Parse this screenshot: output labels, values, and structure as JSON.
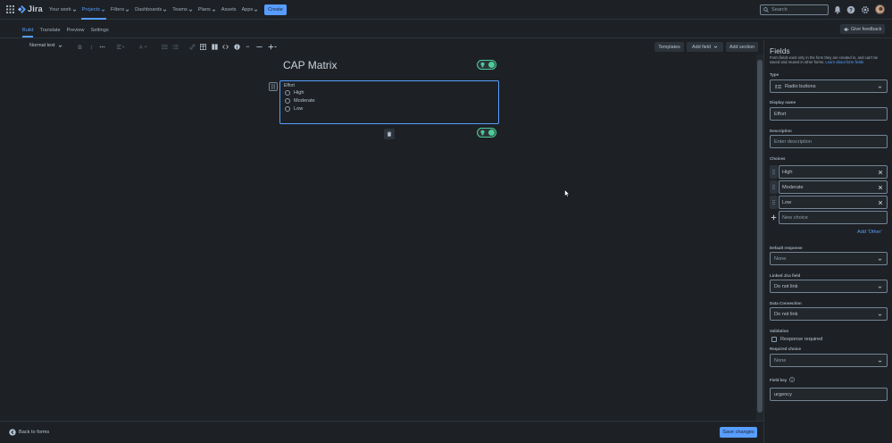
{
  "topnav": {
    "logo_text": "Jira",
    "items": [
      {
        "label": "Your work",
        "active": false
      },
      {
        "label": "Projects",
        "active": true
      },
      {
        "label": "Filters",
        "active": false
      },
      {
        "label": "Dashboards",
        "active": false
      },
      {
        "label": "Teams",
        "active": false
      },
      {
        "label": "Plans",
        "active": false
      },
      {
        "label": "Assets",
        "active": false
      },
      {
        "label": "Apps",
        "active": false
      }
    ],
    "create_label": "Create",
    "search_placeholder": "Search"
  },
  "subtabs": [
    {
      "label": "Build",
      "active": true
    },
    {
      "label": "Translate",
      "active": false
    },
    {
      "label": "Preview",
      "active": false
    },
    {
      "label": "Settings",
      "active": false
    }
  ],
  "feedback_label": "Give feedback",
  "toolbar": {
    "text_style": "Normal text",
    "templates_label": "Templates",
    "add_field_label": "Add field",
    "add_section_label": "Add section"
  },
  "form": {
    "title": "CAP Matrix",
    "field_label": "Effort",
    "options": [
      "High",
      "Moderate",
      "Low"
    ]
  },
  "bottom": {
    "back_label": "Back to forms",
    "save_label": "Save changes"
  },
  "panel": {
    "title": "Fields",
    "description": "Form fields exist only in the form they are created in, and can't be saved and reused in other forms.",
    "learn_link": "Learn about form fields",
    "type_label": "Type",
    "type_value": "Radio buttons",
    "display_name_label": "Display name",
    "display_name_value": "Effort",
    "description_label": "Description",
    "description_placeholder": "Enter description",
    "choices_label": "Choices",
    "choices": [
      "High",
      "Moderate",
      "Low"
    ],
    "new_choice_placeholder": "New choice",
    "add_other_label": "Add 'Other'",
    "default_response_label": "Default response",
    "default_response_value": "None",
    "linked_field_label": "Linked Jira field",
    "linked_field_value": "Do not link",
    "data_connection_label": "Data Connection",
    "data_connection_value": "Do not link",
    "validation_label": "Validation",
    "response_required_label": "Response required",
    "required_choice_label": "Required choice",
    "required_choice_value": "None",
    "field_key_label": "Field key",
    "field_key_value": "urgency"
  },
  "colors": {
    "background": "#1d2125",
    "accent": "#579dff",
    "success": "#4bce97"
  }
}
